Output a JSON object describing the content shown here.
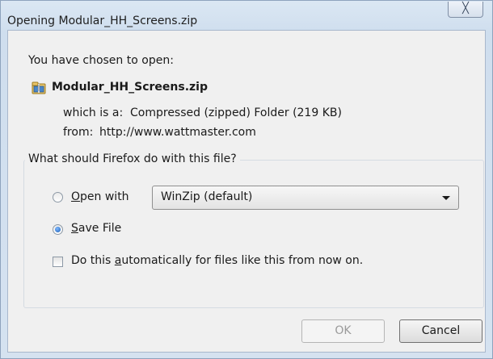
{
  "window": {
    "title": "Opening Modular_HH_Screens.zip",
    "close_glyph": "╳"
  },
  "header": {
    "intro": "You have chosen to open:",
    "file_name": "Modular_HH_Screens.zip",
    "file_icon": "zip-file-icon",
    "type_label": "which is a:",
    "type_value": "Compressed (zipped) Folder (219 KB)",
    "from_label": "from:",
    "from_value": "http://www.wattmaster.com"
  },
  "action_group": {
    "legend": "What should Firefox do with this file?",
    "open_with": {
      "accesskey": "O",
      "rest": "pen with",
      "selected": false,
      "app": "WinZip (default)"
    },
    "save_file": {
      "accesskey": "S",
      "rest": "ave File",
      "selected": true
    },
    "auto_checkbox": {
      "pre": "Do this ",
      "accesskey": "a",
      "post": "utomatically for files like this from now on.",
      "checked": false
    }
  },
  "buttons": {
    "ok_label": "OK",
    "ok_enabled": false,
    "cancel_label": "Cancel"
  },
  "colors": {
    "window_frame": "#dbe7f3",
    "dialog_bg": "#f0f0f0",
    "radio_accent": "#1b5fb5"
  }
}
